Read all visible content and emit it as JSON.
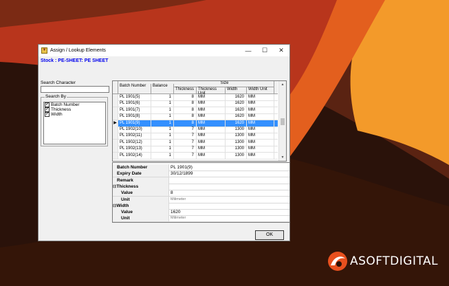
{
  "window": {
    "title": "Assign / Lookup Elements",
    "controls": {
      "minimize": "—",
      "maximize": "☐",
      "close": "✕"
    }
  },
  "stock_label": "Stock : PE-SHEET: PE SHEET",
  "search": {
    "label": "Search Character",
    "value": ""
  },
  "search_by": {
    "legend": "Search By",
    "items": [
      {
        "label": "Batch Number",
        "checked": true
      },
      {
        "label": "Thickness",
        "checked": true
      },
      {
        "label": "Width",
        "checked": true
      }
    ]
  },
  "grid": {
    "headers": {
      "batch": "Batch Number",
      "balance": "Balance",
      "size": "Size",
      "thickness": "Thickness",
      "thickness_unit": "Thickness Unit",
      "width": "Width",
      "width_unit": "Width Unit"
    },
    "rows": [
      {
        "batch": "PL 1901(5)",
        "balance": "1",
        "thickness": "8",
        "thickness_unit": "MM",
        "width": "1620",
        "width_unit": "MM"
      },
      {
        "batch": "PL 1901(6)",
        "balance": "1",
        "thickness": "8",
        "thickness_unit": "MM",
        "width": "1620",
        "width_unit": "MM"
      },
      {
        "batch": "PL 1901(7)",
        "balance": "1",
        "thickness": "8",
        "thickness_unit": "MM",
        "width": "1620",
        "width_unit": "MM"
      },
      {
        "batch": "PL 1901(8)",
        "balance": "1",
        "thickness": "8",
        "thickness_unit": "MM",
        "width": "1620",
        "width_unit": "MM"
      },
      {
        "batch": "PL 1901(9)",
        "balance": "1",
        "thickness": "8",
        "thickness_unit": "MM",
        "width": "1620",
        "width_unit": "MM"
      },
      {
        "batch": "PL 1902(10)",
        "balance": "1",
        "thickness": "7",
        "thickness_unit": "MM",
        "width": "1300",
        "width_unit": "MM"
      },
      {
        "batch": "PL 1902(11)",
        "balance": "1",
        "thickness": "7",
        "thickness_unit": "MM",
        "width": "1300",
        "width_unit": "MM"
      },
      {
        "batch": "PL 1902(12)",
        "balance": "1",
        "thickness": "7",
        "thickness_unit": "MM",
        "width": "1300",
        "width_unit": "MM"
      },
      {
        "batch": "PL 1902(13)",
        "balance": "1",
        "thickness": "7",
        "thickness_unit": "MM",
        "width": "1300",
        "width_unit": "MM"
      },
      {
        "batch": "PL 1902(14)",
        "balance": "1",
        "thickness": "7",
        "thickness_unit": "MM",
        "width": "1300",
        "width_unit": "MM"
      }
    ],
    "selected_index": 4
  },
  "properties": [
    {
      "key": "Batch Number",
      "value": "PL 1901(9)",
      "type": "field"
    },
    {
      "key": "Expiry Date",
      "value": "30/12/1899",
      "type": "field"
    },
    {
      "key": "Remark",
      "value": "",
      "type": "field"
    },
    {
      "key": "Thickness",
      "value": "",
      "type": "category"
    },
    {
      "key": "Value",
      "value": "8",
      "type": "sub"
    },
    {
      "key": "Unit",
      "value": "Milimeter",
      "type": "sub"
    },
    {
      "key": "Width",
      "value": "",
      "type": "category"
    },
    {
      "key": "Value",
      "value": "1620",
      "type": "sub"
    },
    {
      "key": "Unit",
      "value": "Milimeter",
      "type": "sub"
    }
  ],
  "ok_button": "OK",
  "brand": {
    "text": "ASOFTDIGITAL"
  },
  "colors": {
    "selection": "#3390ff",
    "stock_text": "#0000ee",
    "bg_orange": "#f39a2a",
    "bg_red": "#c83a1e",
    "bg_dark": "#2a120a"
  }
}
